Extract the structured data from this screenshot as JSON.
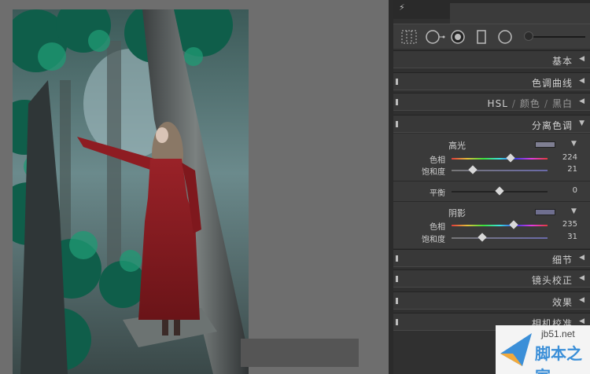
{
  "toolbar": {
    "lightning_glyph": "⚡"
  },
  "panels": {
    "basic": "基本",
    "tone_curve": "色调曲线",
    "hsl": {
      "label": "HSL",
      "color": "颜色",
      "bw": "黑白",
      "separator": "/"
    },
    "split_toning": {
      "title": "分离色调",
      "highlights": {
        "label": "高光",
        "swatch_color": "#7f7f92",
        "hue_label": "色相",
        "hue_value": "224",
        "saturation_label": "饱和度",
        "saturation_value": "21"
      },
      "balance": {
        "label": "平衡",
        "value": "0"
      },
      "shadows": {
        "label": "阴影",
        "swatch_color": "#6f6f8f",
        "hue_label": "色相",
        "hue_value": "235",
        "saturation_label": "饱和度",
        "saturation_value": "31"
      }
    },
    "detail": "细节",
    "lens_corrections": "镜头校正",
    "effects": "效果",
    "camera_calibration": "相机校准"
  },
  "watermark": {
    "line1": "jb51.net",
    "line2": "脚本之家"
  },
  "colors": {
    "panel_bg": "#303030",
    "canvas_bg": "#6e6e6e",
    "dress_red": "#8b1e22"
  }
}
